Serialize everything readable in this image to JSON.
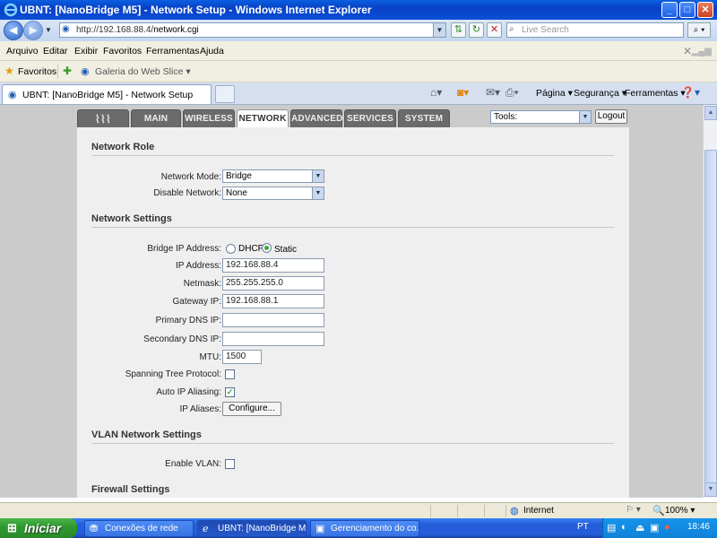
{
  "window": {
    "title": "UBNT: [NanoBridge M5] - Network Setup - Windows Internet Explorer",
    "buttons": {
      "minimize": "_",
      "maximize": "□",
      "close": "✕"
    }
  },
  "address_bar": {
    "url_prefix": "http://192.168.88.4/",
    "url_path": "network.cgi",
    "search_placeholder": "Live Search"
  },
  "menu": [
    "Arquivo",
    "Editar",
    "Exibir",
    "Favoritos",
    "Ferramentas",
    "Ajuda"
  ],
  "favorites_bar": {
    "favorites_label": "Favoritos",
    "web_slice": "Galeria do Web Slice ▾"
  },
  "tab": {
    "label": "UBNT: [NanoBridge M5] - Network Setup"
  },
  "command_bar": {
    "page": "Página ▾",
    "security": "Segurança ▾",
    "tools": "Ferramentas ▾"
  },
  "ubnt": {
    "tabs": [
      "MAIN",
      "WIRELESS",
      "NETWORK",
      "ADVANCED",
      "SERVICES",
      "SYSTEM"
    ],
    "active_tab": "NETWORK",
    "tools_label": "Tools:",
    "logout_label": "Logout"
  },
  "network_role": {
    "heading": "Network Role",
    "network_mode_label": "Network Mode:",
    "network_mode_value": "Bridge",
    "disable_network_label": "Disable Network:",
    "disable_network_value": "None"
  },
  "network_settings": {
    "heading": "Network Settings",
    "bridge_ip_label": "Bridge IP Address:",
    "dhcp_label": "DHCP",
    "static_label": "Static",
    "selected_mode": "Static",
    "ip_label": "IP Address:",
    "ip_value": "192.168.88.4",
    "netmask_label": "Netmask:",
    "netmask_value": "255.255.255.0",
    "gateway_label": "Gateway IP:",
    "gateway_value": "192.168.88.1",
    "primary_dns_label": "Primary DNS IP:",
    "primary_dns_value": "",
    "secondary_dns_label": "Secondary DNS IP:",
    "secondary_dns_value": "",
    "mtu_label": "MTU:",
    "mtu_value": "1500",
    "stp_label": "Spanning Tree Protocol:",
    "stp_checked": false,
    "auto_ip_label": "Auto IP Aliasing:",
    "auto_ip_checked": true,
    "ip_aliases_label": "IP Aliases:",
    "configure_label": "Configure..."
  },
  "vlan": {
    "heading": "VLAN Network Settings",
    "enable_label": "Enable VLAN:",
    "enabled": false
  },
  "firewall": {
    "heading": "Firewall Settings"
  },
  "status_bar": {
    "zone": "Internet",
    "zoom": "100%  ▾"
  },
  "taskbar": {
    "start_label": "Iniciar",
    "tasks": [
      "Conexões de rede",
      "UBNT: [NanoBridge M...",
      "Gerenciamento do co..."
    ],
    "language": "PT",
    "clock": "18:46"
  }
}
